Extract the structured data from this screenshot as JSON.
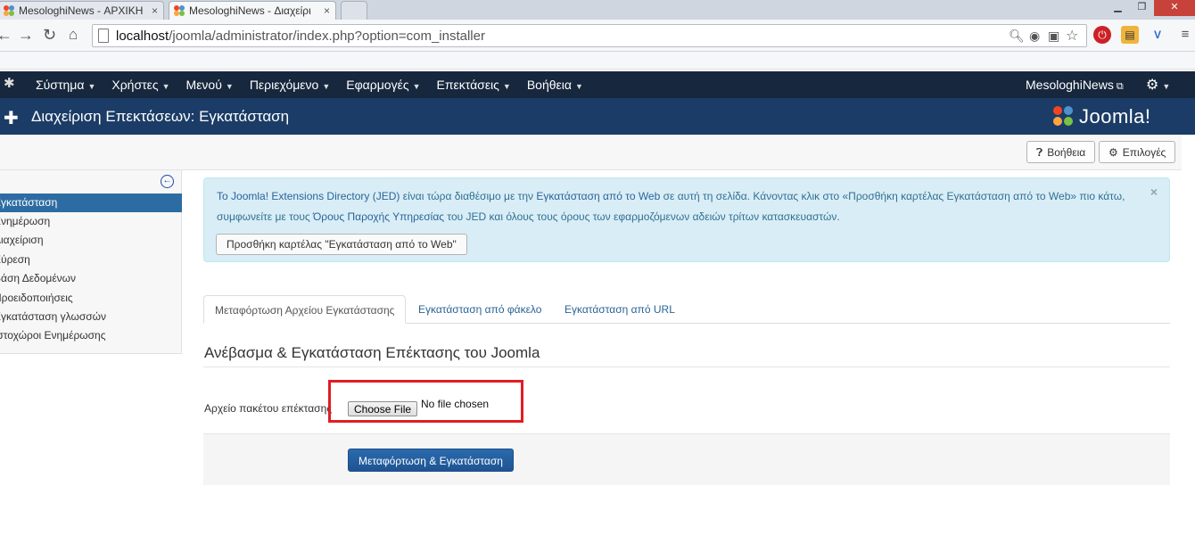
{
  "browser": {
    "tabs": [
      {
        "title": "MesologhiNews - ΑΡΧΙΚΗ",
        "active": false
      },
      {
        "title": "MesologhiNews - Διαχείρι",
        "active": true
      }
    ],
    "tab_close": "×",
    "url_host": "localhost",
    "url_path": "/joomla/administrator/index.php?option=com_installer",
    "icons": [
      "back-icon",
      "forward-icon",
      "reload-icon",
      "home-icon",
      "zoom-icon",
      "bulb-icon",
      "translate-icon",
      "star-icon",
      "menu-icon"
    ]
  },
  "nav": {
    "menu": [
      {
        "label": "Σύστημα"
      },
      {
        "label": "Χρήστες"
      },
      {
        "label": "Μενού"
      },
      {
        "label": "Περιεχόμενο"
      },
      {
        "label": "Εφαρμογές"
      },
      {
        "label": "Επεκτάσεις"
      },
      {
        "label": "Βοήθεια"
      }
    ],
    "site_name": "MesologhiNews"
  },
  "header": {
    "title": "Διαχείριση Επεκτάσεων: Εγκατάσταση",
    "brand": "Joomla!"
  },
  "toolbar": {
    "help_label": "Βοήθεια",
    "options_label": "Επιλογές"
  },
  "sidebar": {
    "items": [
      {
        "label": "Εγκατάσταση",
        "active": true
      },
      {
        "label": "Ενημέρωση",
        "active": false
      },
      {
        "label": "Διαχείριση",
        "active": false
      },
      {
        "label": "Εύρεση",
        "active": false
      },
      {
        "label": "Βάση Δεδομένων",
        "active": false
      },
      {
        "label": "Προειδοποιήσεις",
        "active": false
      },
      {
        "label": "Εγκατάσταση γλωσσών",
        "active": false
      },
      {
        "label": "Ιστοχώροι Ενημέρωσης",
        "active": false
      }
    ]
  },
  "alert": {
    "line1_link1": "Το Joomla! Extensions Directory (JED)",
    "line1_text1": " είναι τώρα διαθέσιμο με την ",
    "line1_link2": "Εγκατάσταση από το Web",
    "line1_text2": " σε αυτή τη σελίδα.  Κάνοντας κλικ στο «Προσθήκη καρτέλας Εγκατάσταση από το Web» πιο κάτω,",
    "line2_text1": "συμφωνείτε με τους ",
    "line2_link": "Όρους Παροχής Υπηρεσίας",
    "line2_text2": " του JED και όλους τους όρους των εφαρμοζόμενων αδειών τρίτων κατασκευαστών.",
    "button": "Προσθήκη καρτέλας \"Εγκατάσταση από το Web\"",
    "close": "×"
  },
  "tabs": [
    {
      "label": "Μεταφόρτωση Αρχείου Εγκατάστασης",
      "active": true
    },
    {
      "label": "Εγκατάσταση από φάκελο",
      "active": false
    },
    {
      "label": "Εγκατάσταση από URL",
      "active": false
    }
  ],
  "upload": {
    "heading": "Ανέβασμα & Εγκατάσταση Επέκτασης του Joomla",
    "field_label": "Αρχείο πακέτου επέκτασης",
    "choose_file": "Choose File",
    "no_file": "No file chosen",
    "submit": "Μεταφόρτωση & Εγκατάσταση"
  },
  "colors": {
    "navbar": "#17273d",
    "subheader": "#1b3c66",
    "sidebar_active": "#2d6ca2",
    "alert_bg": "#d9edf7",
    "highlight": "#e01c24",
    "primary_button": "#1f5493"
  }
}
